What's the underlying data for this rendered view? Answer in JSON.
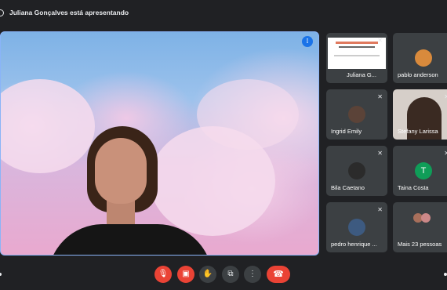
{
  "header": {
    "presenting_text": "Juliana Gonçalves está apresentando"
  },
  "main_video": {
    "speaker_indicator_icon": "audio-level-icon"
  },
  "participants": [
    {
      "name": "Juliana G...",
      "type": "slide",
      "muted": true
    },
    {
      "name": "pablo anderson",
      "type": "avatar",
      "avatar_letter": "",
      "muted": false
    },
    {
      "name": "Ingrid Emily",
      "type": "avatar",
      "avatar_letter": "",
      "muted": true
    },
    {
      "name": "Stefany Larissa",
      "type": "photo",
      "muted": true
    },
    {
      "name": "Bila Caetano",
      "type": "avatar",
      "avatar_letter": "",
      "muted": true
    },
    {
      "name": "Taina Costa",
      "type": "avatar",
      "avatar_letter": "T",
      "muted": true
    },
    {
      "name": "pedro henrique ...",
      "type": "avatar",
      "avatar_letter": "",
      "muted": true
    },
    {
      "name": "Mais 23 pessoas",
      "type": "group",
      "muted": false
    }
  ],
  "controls": {
    "mic_icon": "mic-off-icon",
    "camera_icon": "camera-off-icon",
    "raise_hand_icon": "raise-hand-icon",
    "present_icon": "present-screen-icon",
    "more_icon": "more-options-icon",
    "end_call_icon": "end-call-icon"
  },
  "colors": {
    "background": "#202124",
    "tile": "#3c4043",
    "danger": "#ea4335",
    "accent": "#8ab4f8",
    "avatar_t": "#0f9d58"
  }
}
